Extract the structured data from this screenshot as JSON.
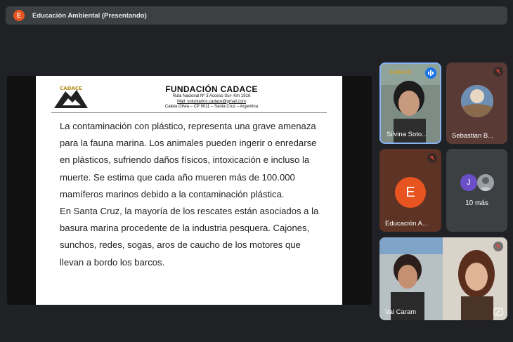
{
  "meeting": {
    "presenter_initial": "E",
    "title": "Educación Ambiental (Presentando)"
  },
  "slide": {
    "logo_text": "CADACE",
    "org_name": "FUNDACIÓN CADACE",
    "address_line1": "Ruta Nacional Nº 3 Acceso Sur- Km 1916",
    "mail_line": "Mail: voluntarios.cadace@gmail.com",
    "address_line2": "Caleta Olivia – CP 9011 – Santa Cruz – Argentina",
    "paragraph1": "La contaminación con plástico, representa una grave amenaza para la fauna marina. Los animales pueden ingerir o enredarse en plásticos, sufriendo daños físicos, intoxicación e incluso la muerte. Se estima que cada año mueren más de 100.000 mamíferos marinos debido a la contaminación plástica.",
    "paragraph2": "En Santa Cruz, la mayoría de los rescates están asociados a la basura marina procedente de la industria pesquera. Cajones, sunchos, redes, sogas, aros de caucho de los motores que llevan a bordo los barcos."
  },
  "participants": [
    {
      "name": "Silvina Soto...",
      "state": "speaking"
    },
    {
      "name": "Sebastian B...",
      "state": "muted"
    },
    {
      "name": "Educación A...",
      "initial": "E",
      "state": "muted",
      "avatar_color": "#e8541f"
    },
    {
      "more_label": "10 más",
      "initial": "J",
      "avatar_color": "#6a4fc9"
    },
    {
      "name": "Val Caram",
      "state": "muted"
    }
  ],
  "colors": {
    "background": "#202124",
    "topbar": "#3c4043",
    "accent_orange": "#e8541f",
    "speaking_blue": "#1a73e8",
    "mute_red": "#ea4335"
  }
}
